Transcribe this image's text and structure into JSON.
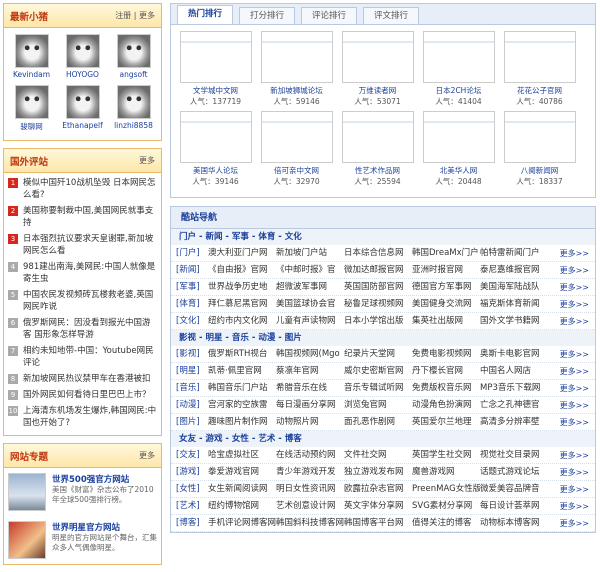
{
  "newest": {
    "title": "最新小猪",
    "register": "注册",
    "more": "更多",
    "users": [
      "Kevindam",
      "HOYOGO",
      "angsoft",
      "骏聊网",
      "Ethanapelf",
      "linzhi8858"
    ]
  },
  "foreign": {
    "title": "国外评站",
    "more": "更多",
    "items": [
      {
        "n": "1",
        "t": "模似中国歼10战机坠毁 日本网民怎么看?"
      },
      {
        "n": "2",
        "t": "美国称要制裁中国,美国网民就事支持"
      },
      {
        "n": "3",
        "t": "日本强烈抗议要求天皇谢罪,新加坡网民怎么看"
      },
      {
        "n": "4",
        "t": "981建出南海,美网民:中国人就像是寄生虫"
      },
      {
        "n": "5",
        "t": "中国农民发视频砖瓦楼救老婆,英国网民咋说"
      },
      {
        "n": "6",
        "t": "俄罗斯网民：因没看到报光中国游客 国形象怎样导游"
      },
      {
        "n": "7",
        "t": "相约未知地带-中国：Youtube网民评论"
      },
      {
        "n": "8",
        "t": "新加坡网民热议禁甲车在香港被扣"
      },
      {
        "n": "9",
        "t": "国外网民如何看待日里巴巴上市？"
      },
      {
        "n": "10",
        "t": "上海清东机场发生爆炸,韩国网民:中国也开始了?"
      }
    ]
  },
  "topics": {
    "title": "网站专题",
    "more": "更多",
    "items": [
      {
        "t": "世界500强官方网站",
        "d": "美国《财富》杂志公布了2010年全球500强排行榜。"
      },
      {
        "t": "世界明星官方网站",
        "d": "明星的官方网站是个舞台，汇集众多人气偶像明星。"
      }
    ]
  },
  "tabs": [
    "热门排行",
    "打分排行",
    "评论排行",
    "评文排行"
  ],
  "rankLabel": "人气：",
  "sites": [
    {
      "n": "文学城中文网",
      "p": "137719"
    },
    {
      "n": "新加坡狮城论坛",
      "p": "59146"
    },
    {
      "n": "万维读者网",
      "p": "53071"
    },
    {
      "n": "日本2CH论坛",
      "p": "41404"
    },
    {
      "n": "花花公子官网",
      "p": "40786"
    },
    {
      "n": "美国华人论坛",
      "p": "39146"
    },
    {
      "n": "倍可亲中文网",
      "p": "32970"
    },
    {
      "n": "性艺术作品网",
      "p": "25594"
    },
    {
      "n": "北美华人网",
      "p": "20448"
    },
    {
      "n": "八阕新闻网",
      "p": "18337"
    }
  ],
  "nav": {
    "title": "酷站导航",
    "more": "更多>>",
    "sections": [
      {
        "head": "门户 - 新闻 - 军事 - 体育 - 文化",
        "rows": [
          {
            "c": "[门户]",
            "s": [
              "澳大利亚门户网",
              "新加坡门户站",
              "日本综合信息网",
              "韩国DreaMx门户",
              "帕特雷新闻门户"
            ]
          },
          {
            "c": "[新闻]",
            "s": [
              "《自由报》官网",
              "《中邮时报》官",
              "微加达邮报官网",
              "亚洲时报官网",
              "泰尼嘉维报官网"
            ]
          },
          {
            "c": "[军事]",
            "s": [
              "世界战争历史地",
              "超微波军事网",
              "英国国防部官网",
              "德国官方军事网",
              "美国海军陆战队"
            ]
          },
          {
            "c": "[体育]",
            "s": [
              "拜仁慕尼黑官网",
              "美国篮球协会官",
              "秘鲁足球视频网",
              "美国健身交流网",
              "福克斯体育新闻"
            ]
          },
          {
            "c": "[文化]",
            "s": [
              "纽约市内文化网",
              "儿童有声读物网",
              "日本小学馆出版",
              "集英社出版网",
              "国外文学书籍网"
            ]
          }
        ]
      },
      {
        "head": "影视 - 明星 - 音乐 - 动漫 - 图片",
        "rows": [
          {
            "c": "[影视]",
            "s": [
              "俄罗斯RTH视台",
              "韩国视频网(Mgo",
              "纪录片天堂网",
              "免费电影视频网",
              "奥斯卡电影官网"
            ]
          },
          {
            "c": "[明星]",
            "s": [
              "凯蒂·佩里官网",
              "蔡凛年官网",
              "威尔史密斯官网",
              "丹下樱长官网",
              "中国名人网店"
            ]
          },
          {
            "c": "[音乐]",
            "s": [
              "韩国音乐门户站",
              "希腊音乐在线",
              "音乐专辑试听网",
              "免费版权音乐网",
              "MP3音乐下载网"
            ]
          },
          {
            "c": "[动漫]",
            "s": [
              "宫河家的空族雷",
              "每日漫画分享网",
              "浏览兔官网",
              "动漫角色扮演网",
              "亡念之孔神德官"
            ]
          },
          {
            "c": "[图片]",
            "s": [
              "趣味图片制作网",
              "动物照片网",
              "面孔恶作剧网",
              "英国爱尔兰地理",
              "高清多分辨率壁"
            ]
          }
        ]
      },
      {
        "head": "女友 - 游戏 - 女性 - 艺术 - 博客",
        "rows": [
          {
            "c": "[交友]",
            "s": [
              "哈宝虚拟社区",
              "在线活动预约网",
              "文件社交网",
              "英国学生社交网",
              "视觉社交目录网"
            ]
          },
          {
            "c": "[游戏]",
            "s": [
              "拳爱游戏官网",
              "青少年游戏开发",
              "独立游戏发布网",
              "魔兽游戏网",
              "话题式游戏论坛"
            ]
          },
          {
            "c": "[女性]",
            "s": [
              "女生新闻阅读网",
              "明日女性资讯网",
              "欧露拉杂志官网",
              "PreenMAG女性版",
              "微爱美容品牌音"
            ]
          },
          {
            "c": "[艺术]",
            "s": [
              "纽约博物馆网",
              "艺术创意设计网",
              "英文字体分享网",
              "SVG素材分享网",
              "每日设计荟萃网"
            ]
          },
          {
            "c": "[博客]",
            "s": [
              "手机评论网博客网",
              "韩国斜科技博客网",
              "韩国博客平台网",
              "值得关注的博客",
              "动物标本博客网"
            ]
          }
        ]
      }
    ]
  }
}
